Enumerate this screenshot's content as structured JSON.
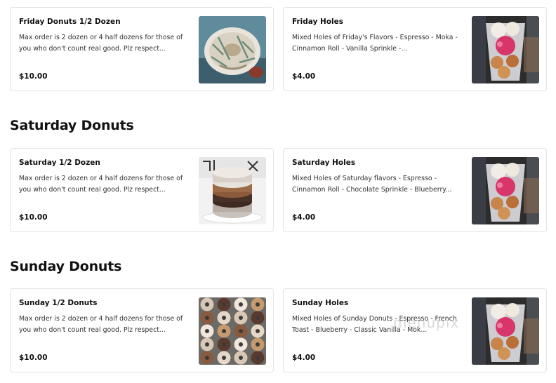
{
  "sections": [
    {
      "title": "",
      "items": [
        {
          "name": "Friday Donuts 1/2 Dozen",
          "description": "Max order is 2 dozen or 4 half dozens for those of you who don't count real good. Plz respect...",
          "price": "$10.00",
          "image_icon": "donut-photo"
        },
        {
          "name": "Friday Holes",
          "description": "Mixed Holes of Friday's Flavors - Espresso - Moka - Cinnamon Roll - Vanilla Sprinkle -...",
          "price": "$4.00",
          "image_icon": "donut-holes-cup-photo"
        }
      ]
    },
    {
      "title": "Saturday Donuts",
      "items": [
        {
          "name": "Saturday 1/2 Dozen",
          "description": "Max order is 2 dozen or 4 half dozens for those of you who don't count real good. Plz respect...",
          "price": "$10.00",
          "image_icon": "donut-stack-photo"
        },
        {
          "name": "Saturday Holes",
          "description": "Mixed Holes of Saturday flavors - Espresso - Cinnamon Roll - Chocolate Sprinkle - Blueberry...",
          "price": "$4.00",
          "image_icon": "donut-holes-cup-photo"
        }
      ]
    },
    {
      "title": "Sunday Donuts",
      "items": [
        {
          "name": "Sunday 1/2 Donuts",
          "description": "Max order is 2 dozen or 4 half dozens for those of you who don't count real good. Plz respect...",
          "price": "$10.00",
          "image_icon": "donut-rack-photo"
        },
        {
          "name": "Sunday Holes",
          "description": "Mixed Holes of Sunday Donuts - Espresso - French Toast - Blueberry - Classic Vanilla - Mok...",
          "price": "$4.00",
          "image_icon": "donut-holes-cup-photo"
        }
      ]
    }
  ],
  "watermark": "menupix",
  "colors": {
    "card_border": "#e3e3e3",
    "text_primary": "#111111",
    "text_secondary": "#333333",
    "background": "#ffffff"
  }
}
